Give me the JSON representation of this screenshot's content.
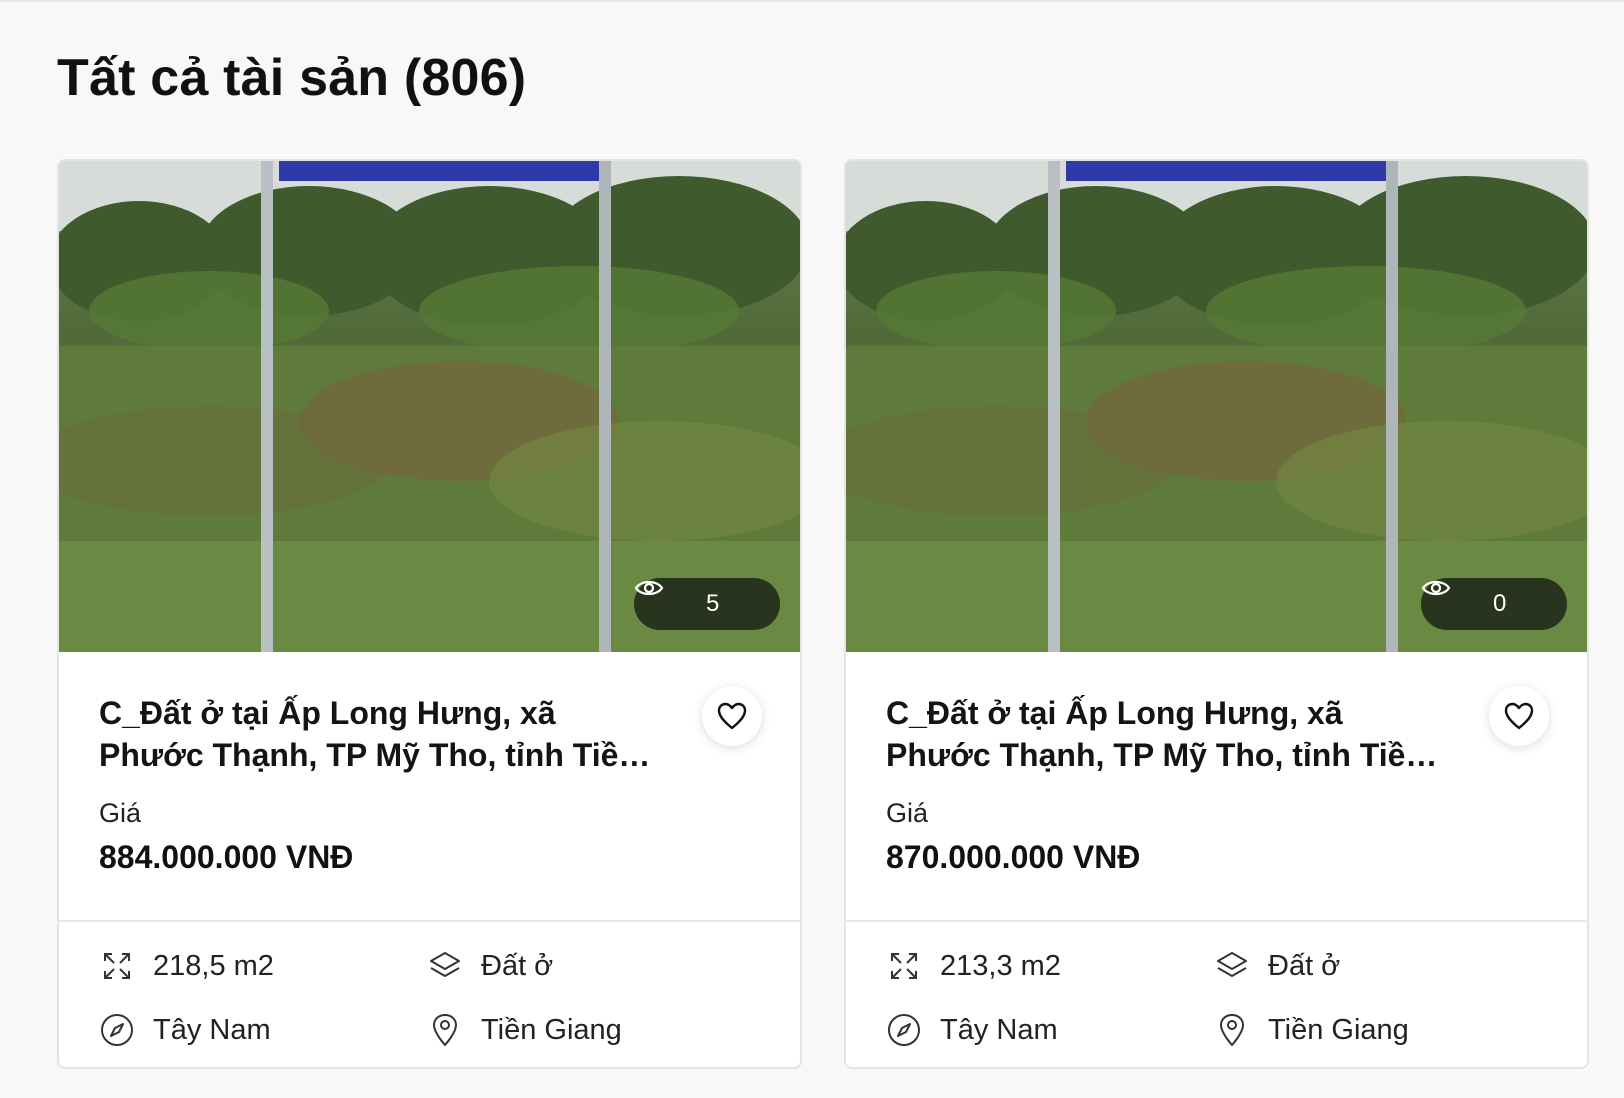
{
  "page": {
    "title": "Tất cả tài sản (806)"
  },
  "cards": [
    {
      "views": "5",
      "name": "C_Đất ở tại Ấp Long Hưng, xã Phước Thạnh, TP Mỹ Tho, tỉnh Tiền Giang...",
      "price_label": "Giá",
      "price": "884.000.000 VNĐ",
      "area": "218,5 m2",
      "land_type": "Đất ở",
      "direction": "Tây Nam",
      "province": "Tiền Giang"
    },
    {
      "views": "0",
      "name": "C_Đất ở tại Ấp Long Hưng, xã Phước Thạnh, TP Mỹ Tho, tỉnh Tiền Giang...",
      "price_label": "Giá",
      "price": "870.000.000 VNĐ",
      "area": "213,3 m2",
      "land_type": "Đất ở",
      "direction": "Tây Nam",
      "province": "Tiền Giang"
    }
  ],
  "icons": {
    "views": "eye-icon",
    "favorite": "heart-icon",
    "area": "expand-icon",
    "land_type": "layers-icon",
    "direction": "compass-icon",
    "province": "map-pin-icon"
  }
}
